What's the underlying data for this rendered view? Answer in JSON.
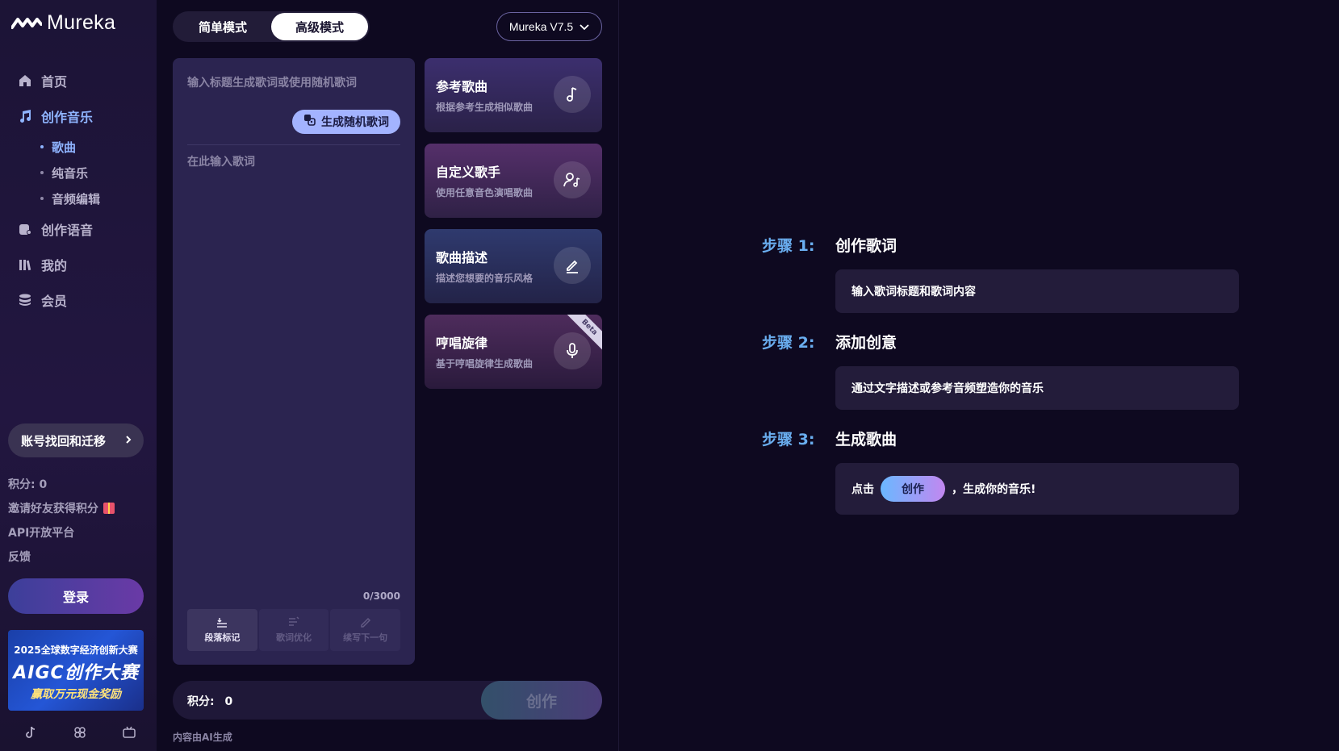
{
  "app": {
    "logo_text": "Mureka"
  },
  "sidebar": {
    "items": [
      {
        "label": "首页",
        "icon": "home-icon"
      },
      {
        "label": "创作音乐",
        "icon": "music-note-icon",
        "active": true
      },
      {
        "label": "创作语音",
        "icon": "voice-icon"
      },
      {
        "label": "我的",
        "icon": "library-icon"
      },
      {
        "label": "会员",
        "icon": "coins-icon"
      }
    ],
    "subitems": [
      {
        "label": "歌曲",
        "active": true
      },
      {
        "label": "纯音乐"
      },
      {
        "label": "音频编辑"
      }
    ],
    "account_button": "账号找回和迁移",
    "points": "积分: 0",
    "invite": "邀请好友获得积分",
    "api": "API开放平台",
    "feedback": "反馈",
    "login": "登录",
    "banner": {
      "line1": "2025全球数字经济创新大赛",
      "line2": "AIGC创作大赛",
      "line3": "赢取万元现金奖励"
    }
  },
  "header": {
    "modes": [
      "简单模式",
      "高级模式"
    ],
    "active_mode": "高级模式",
    "version": "Mureka V7.5"
  },
  "editor": {
    "title_placeholder": "输入标题生成歌词或使用随机歌词",
    "random_button": "生成随机歌词",
    "lyrics_placeholder": "在此输入歌词",
    "counter": "0/3000",
    "tools": [
      "段落标记",
      "歌词优化",
      "续写下一句"
    ]
  },
  "cards": [
    {
      "title": "参考歌曲",
      "subtitle": "根据参考生成相似歌曲"
    },
    {
      "title": "自定义歌手",
      "subtitle": "使用任意音色演唱歌曲"
    },
    {
      "title": "歌曲描述",
      "subtitle": "描述您想要的音乐风格"
    },
    {
      "title": "哼唱旋律",
      "subtitle": "基于哼唱旋律生成歌曲",
      "badge": "Beta"
    }
  ],
  "bottom": {
    "points_label": "积分:",
    "points_value": "0",
    "create": "创作",
    "ai_note": "内容由AI生成"
  },
  "steps": [
    {
      "num": "步骤 1:",
      "title": "创作歌词",
      "desc": "输入歌词标题和歌词内容"
    },
    {
      "num": "步骤 2:",
      "title": "添加创意",
      "desc": "通过文字描述或参考音频塑造你的音乐"
    },
    {
      "num": "步骤 3:",
      "title": "生成歌曲",
      "desc_pre": "点击",
      "desc_btn": "创作",
      "desc_post": "，生成你的音乐!"
    }
  ]
}
